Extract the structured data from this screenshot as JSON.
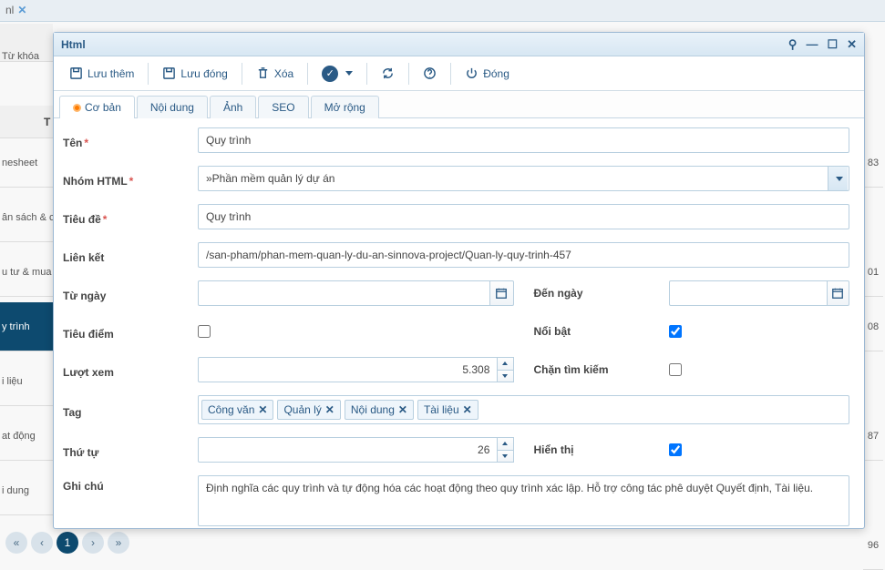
{
  "bg": {
    "tab_label": "nl",
    "search_label": "Từ khóa",
    "header": "T",
    "rows": [
      "nesheet",
      "ân sách & c",
      "u tư & mua",
      "y trình",
      "i liệu",
      "at động",
      "i dung"
    ],
    "selected_index": 3,
    "nums": [
      "83",
      "",
      "01",
      "08",
      "",
      "87",
      "",
      "96"
    ],
    "pager_current": "1"
  },
  "dialog": {
    "title": "Html",
    "toolbar": {
      "save_add": "Lưu thêm",
      "save_close": "Lưu đóng",
      "delete": "Xóa",
      "close": "Đóng"
    },
    "tabs": [
      "Cơ bản",
      "Nội dung",
      "Ảnh",
      "SEO",
      "Mở rộng"
    ],
    "active_tab": 0
  },
  "form": {
    "name_label": "Tên",
    "name_value": "Quy trình",
    "group_label": "Nhóm HTML",
    "group_value": "»Phần mềm quản lý dự án",
    "title_label": "Tiêu đề",
    "title_value": "Quy trình",
    "link_label": "Liên kết",
    "link_value": "/san-pham/phan-mem-quan-ly-du-an-sinnova-project/Quan-ly-quy-trinh-457",
    "from_label": "Từ ngày",
    "from_value": "",
    "to_label": "Đến ngày",
    "to_value": "",
    "focus_label": "Tiêu điểm",
    "featured_label": "Nổi bật",
    "views_label": "Lượt xem",
    "views_value": "5.308",
    "block_search_label": "Chặn tìm kiếm",
    "tag_label": "Tag",
    "tags": [
      "Công văn",
      "Quản lý",
      "Nội dung",
      "Tài liệu"
    ],
    "order_label": "Thứ tự",
    "order_value": "26",
    "visible_label": "Hiển thị",
    "note_label": "Ghi chú",
    "note_value": "Định nghĩa các quy trình và tự động hóa các hoạt động theo quy trình xác lập. Hỗ trợ công tác phê duyệt Quyết định, Tài liệu."
  }
}
